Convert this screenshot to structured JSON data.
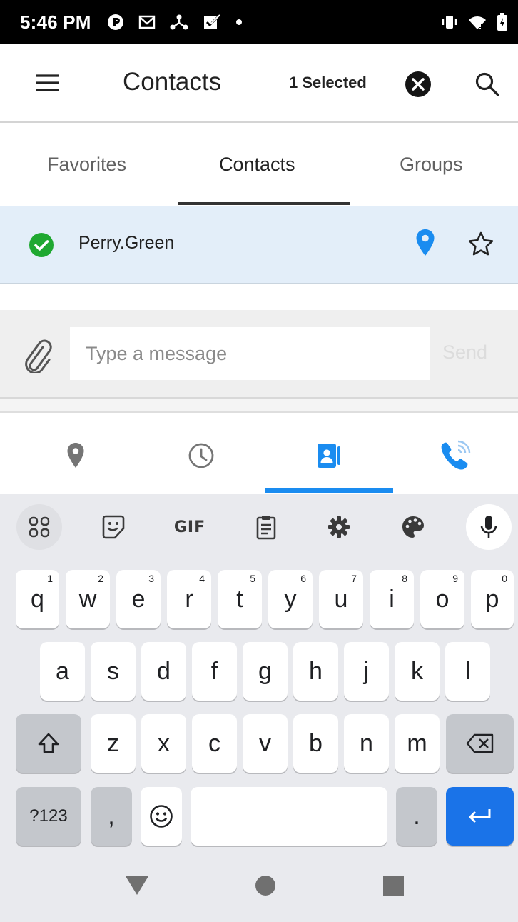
{
  "status_bar": {
    "time": "5:46 PM",
    "icons": [
      "location-p-icon",
      "mail-icon",
      "network-icon",
      "checkbox-icon",
      "dot-icon"
    ],
    "right_icons": [
      "vibrate-icon",
      "wifi-icon",
      "battery-icon"
    ]
  },
  "app_bar": {
    "title": "Contacts",
    "selected_count": "1 Selected",
    "icons": [
      "menu-icon",
      "clear-icon",
      "search-icon"
    ]
  },
  "tabs": [
    {
      "label": "Favorites",
      "active": false
    },
    {
      "label": "Contacts",
      "active": true
    },
    {
      "label": "Groups",
      "active": false
    }
  ],
  "contact_list": [
    {
      "name": "Perry.Green",
      "selected": true,
      "icons": [
        "check-circle-icon",
        "location-pin-icon",
        "star-outline-icon"
      ]
    }
  ],
  "compose": {
    "placeholder": "Type a message",
    "value": "",
    "send_label": "Send"
  },
  "bottom_nav": {
    "items": [
      "location-icon",
      "clock-icon",
      "contacts-icon",
      "call-icon"
    ],
    "active_index": 2
  },
  "keyboard": {
    "toolbar": [
      "apps-grid-icon",
      "sticker-icon",
      "GIF",
      "clipboard-icon",
      "settings-icon",
      "palette-icon",
      "mic-icon"
    ],
    "row1": [
      "q",
      "w",
      "e",
      "r",
      "t",
      "y",
      "u",
      "i",
      "o",
      "p"
    ],
    "row1_hints": [
      "1",
      "2",
      "3",
      "4",
      "5",
      "6",
      "7",
      "8",
      "9",
      "0"
    ],
    "row2": [
      "a",
      "s",
      "d",
      "f",
      "g",
      "h",
      "j",
      "k",
      "l"
    ],
    "row3": [
      "z",
      "x",
      "c",
      "v",
      "b",
      "n",
      "m"
    ],
    "symbols_label": "?123",
    "comma": ",",
    "period": "."
  },
  "colors": {
    "accent": "#1a8cf0",
    "selected_row": "#e3eef9",
    "check_green": "#1fa831",
    "enter_key": "#1a73e8"
  }
}
